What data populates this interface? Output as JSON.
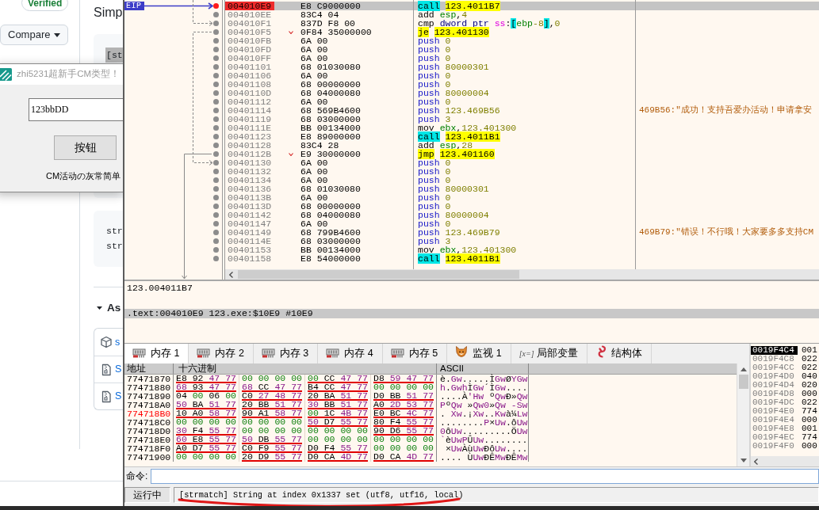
{
  "web_page": {
    "badge": "Verified",
    "compare_button": "Compare",
    "heading": "Simp",
    "code_blocks": [
      {
        "lines": [
          {
            "text": "[st",
            "selected": true
          }
        ]
      },
      {
        "lines": [
          {
            "text": "str",
            "selected": false
          },
          {
            "text": "str",
            "selected": false
          }
        ]
      }
    ],
    "section": {
      "title": "As",
      "expanded": true
    },
    "assets": [
      {
        "kind": "package",
        "name": "s"
      },
      {
        "kind": "archive",
        "name": "S"
      },
      {
        "kind": "archive",
        "name": "S"
      }
    ]
  },
  "dialog": {
    "title": "zhi5231超新手CM类型！",
    "active": false,
    "input": {
      "value": "123bbDD"
    },
    "button": "按钮",
    "label": "CM活动の灰常简单"
  },
  "debugger": {
    "disassembly": {
      "eip_label": "EIP",
      "rows": [
        {
          "address": "004010E9",
          "bytes": "E8 C9000000",
          "mnemonic": "call",
          "kind": "call",
          "operands": [
            {
              "text": "123.4011B7",
              "kind": "target"
            }
          ],
          "selected": true,
          "breakpoint": true,
          "eip": true,
          "jump_in": false,
          "jump_out": false
        },
        {
          "address": "004010EE",
          "bytes": "83C4 04",
          "mnemonic": "add",
          "kind": "plain",
          "operands": [
            {
              "text": "esp",
              "kind": "register"
            },
            {
              "text": ",",
              "kind": "plain"
            },
            {
              "text": "4",
              "kind": "number"
            }
          ],
          "selected": false,
          "breakpoint": false,
          "eip": false,
          "jump_in": false,
          "jump_out": false
        },
        {
          "address": "004010F1",
          "bytes": "837D F8 00",
          "mnemonic": "cmp",
          "kind": "plain",
          "operands": [
            {
              "text": "dword ptr ",
              "kind": "size"
            },
            {
              "text": "ss",
              "kind": "segment"
            },
            {
              "text": ":",
              "kind": "plain"
            },
            {
              "text": "[",
              "kind": "bracket"
            },
            {
              "text": "ebp",
              "kind": "register"
            },
            {
              "text": "-8",
              "kind": "number"
            },
            {
              "text": "]",
              "kind": "bracket"
            },
            {
              "text": ",",
              "kind": "plain"
            },
            {
              "text": "0",
              "kind": "number"
            }
          ],
          "selected": false,
          "breakpoint": false,
          "eip": false,
          "jump_in": true,
          "jump_out": false,
          "dashed": true
        },
        {
          "address": "004010F5",
          "bytes": "0F84 35000000",
          "mnemonic": "je",
          "kind": "jump",
          "operands": [
            {
              "text": "123.401130",
              "kind": "target"
            }
          ],
          "selected": false,
          "breakpoint": false,
          "eip": false,
          "jump_in": false,
          "jump_out": true,
          "dashed": true
        },
        {
          "address": "004010FB",
          "bytes": "6A 00",
          "mnemonic": "push",
          "kind": "push",
          "operands": [
            {
              "text": "0",
              "kind": "number"
            }
          ],
          "selected": false,
          "breakpoint": false,
          "eip": false,
          "jump_in": false,
          "jump_out": false
        },
        {
          "address": "004010FD",
          "bytes": "6A 00",
          "mnemonic": "push",
          "kind": "push",
          "operands": [
            {
              "text": "0",
              "kind": "number"
            }
          ],
          "selected": false,
          "breakpoint": false,
          "eip": false,
          "jump_in": false,
          "jump_out": false
        },
        {
          "address": "004010FF",
          "bytes": "6A 00",
          "mnemonic": "push",
          "kind": "push",
          "operands": [
            {
              "text": "0",
              "kind": "number"
            }
          ],
          "selected": false,
          "breakpoint": false,
          "eip": false,
          "jump_in": false,
          "jump_out": false
        },
        {
          "address": "00401101",
          "bytes": "68 01030080",
          "mnemonic": "push",
          "kind": "push",
          "operands": [
            {
              "text": "80000301",
              "kind": "number"
            }
          ],
          "selected": false,
          "breakpoint": false,
          "eip": false,
          "jump_in": false,
          "jump_out": false
        },
        {
          "address": "00401106",
          "bytes": "6A 00",
          "mnemonic": "push",
          "kind": "push",
          "operands": [
            {
              "text": "0",
              "kind": "number"
            }
          ],
          "selected": false,
          "breakpoint": false,
          "eip": false,
          "jump_in": false,
          "jump_out": false
        },
        {
          "address": "00401108",
          "bytes": "68 00000000",
          "mnemonic": "push",
          "kind": "push",
          "operands": [
            {
              "text": "0",
              "kind": "number"
            }
          ],
          "selected": false,
          "breakpoint": false,
          "eip": false,
          "jump_in": false,
          "jump_out": false
        },
        {
          "address": "0040110D",
          "bytes": "68 04000080",
          "mnemonic": "push",
          "kind": "push",
          "operands": [
            {
              "text": "80000004",
              "kind": "number"
            }
          ],
          "selected": false,
          "breakpoint": false,
          "eip": false,
          "jump_in": false,
          "jump_out": false
        },
        {
          "address": "00401112",
          "bytes": "6A 00",
          "mnemonic": "push",
          "kind": "push",
          "operands": [
            {
              "text": "0",
              "kind": "number"
            }
          ],
          "selected": false,
          "breakpoint": false,
          "eip": false,
          "jump_in": false,
          "jump_out": false
        },
        {
          "address": "00401114",
          "bytes": "68 569B4600",
          "mnemonic": "push",
          "kind": "push",
          "operands": [
            {
              "text": "123.469B56",
              "kind": "number"
            }
          ],
          "comment": "469B56:\"成功！支持吾爱办活动！申请拿安",
          "selected": false,
          "breakpoint": false,
          "eip": false,
          "jump_in": false,
          "jump_out": false
        },
        {
          "address": "00401119",
          "bytes": "68 03000000",
          "mnemonic": "push",
          "kind": "push",
          "operands": [
            {
              "text": "3",
              "kind": "number"
            }
          ],
          "selected": false,
          "breakpoint": false,
          "eip": false,
          "jump_in": false,
          "jump_out": false
        },
        {
          "address": "0040111E",
          "bytes": "BB 00134000",
          "mnemonic": "mov",
          "kind": "plain",
          "operands": [
            {
              "text": "ebx",
              "kind": "register"
            },
            {
              "text": ",",
              "kind": "plain"
            },
            {
              "text": "123.401300",
              "kind": "number"
            }
          ],
          "selected": false,
          "breakpoint": false,
          "eip": false,
          "jump_in": false,
          "jump_out": false
        },
        {
          "address": "00401123",
          "bytes": "E8 89000000",
          "mnemonic": "call",
          "kind": "call",
          "operands": [
            {
              "text": "123.4011B1",
              "kind": "target"
            }
          ],
          "selected": false,
          "breakpoint": false,
          "eip": false,
          "jump_in": false,
          "jump_out": false
        },
        {
          "address": "00401128",
          "bytes": "83C4 28",
          "mnemonic": "add",
          "kind": "plain",
          "operands": [
            {
              "text": "esp",
              "kind": "register"
            },
            {
              "text": ",",
              "kind": "plain"
            },
            {
              "text": "28",
              "kind": "number"
            }
          ],
          "selected": false,
          "breakpoint": false,
          "eip": false,
          "jump_in": false,
          "jump_out": false
        },
        {
          "address": "0040112B",
          "bytes": "E9 30000000",
          "mnemonic": "jmp",
          "kind": "jump",
          "operands": [
            {
              "text": "123.401160",
              "kind": "target"
            }
          ],
          "selected": false,
          "breakpoint": false,
          "eip": false,
          "jump_in": false,
          "jump_out": true,
          "dashed": false
        },
        {
          "address": "00401130",
          "bytes": "6A 00",
          "mnemonic": "push",
          "kind": "push",
          "operands": [
            {
              "text": "0",
              "kind": "number"
            }
          ],
          "selected": false,
          "breakpoint": false,
          "eip": false,
          "jump_in": true,
          "jump_out": false,
          "dashed": true
        },
        {
          "address": "00401132",
          "bytes": "6A 00",
          "mnemonic": "push",
          "kind": "push",
          "operands": [
            {
              "text": "0",
              "kind": "number"
            }
          ],
          "selected": false,
          "breakpoint": false,
          "eip": false,
          "jump_in": false,
          "jump_out": false
        },
        {
          "address": "00401134",
          "bytes": "6A 00",
          "mnemonic": "push",
          "kind": "push",
          "operands": [
            {
              "text": "0",
              "kind": "number"
            }
          ],
          "selected": false,
          "breakpoint": false,
          "eip": false,
          "jump_in": false,
          "jump_out": false
        },
        {
          "address": "00401136",
          "bytes": "68 01030080",
          "mnemonic": "push",
          "kind": "push",
          "operands": [
            {
              "text": "80000301",
              "kind": "number"
            }
          ],
          "selected": false,
          "breakpoint": false,
          "eip": false,
          "jump_in": false,
          "jump_out": false
        },
        {
          "address": "0040113B",
          "bytes": "6A 00",
          "mnemonic": "push",
          "kind": "push",
          "operands": [
            {
              "text": "0",
              "kind": "number"
            }
          ],
          "selected": false,
          "breakpoint": false,
          "eip": false,
          "jump_in": false,
          "jump_out": false
        },
        {
          "address": "0040113D",
          "bytes": "68 00000000",
          "mnemonic": "push",
          "kind": "push",
          "operands": [
            {
              "text": "0",
              "kind": "number"
            }
          ],
          "selected": false,
          "breakpoint": false,
          "eip": false,
          "jump_in": false,
          "jump_out": false
        },
        {
          "address": "00401142",
          "bytes": "68 04000080",
          "mnemonic": "push",
          "kind": "push",
          "operands": [
            {
              "text": "80000004",
              "kind": "number"
            }
          ],
          "selected": false,
          "breakpoint": false,
          "eip": false,
          "jump_in": false,
          "jump_out": false
        },
        {
          "address": "00401147",
          "bytes": "6A 00",
          "mnemonic": "push",
          "kind": "push",
          "operands": [
            {
              "text": "0",
              "kind": "number"
            }
          ],
          "selected": false,
          "breakpoint": false,
          "eip": false,
          "jump_in": false,
          "jump_out": false
        },
        {
          "address": "00401149",
          "bytes": "68 799B4600",
          "mnemonic": "push",
          "kind": "push",
          "operands": [
            {
              "text": "123.469B79",
              "kind": "number"
            }
          ],
          "comment": "469B79:\"错误！不行哦！大家要多多支持CM",
          "selected": false,
          "breakpoint": false,
          "eip": false,
          "jump_in": false,
          "jump_out": false
        },
        {
          "address": "0040114E",
          "bytes": "68 03000000",
          "mnemonic": "push",
          "kind": "push",
          "operands": [
            {
              "text": "3",
              "kind": "number"
            }
          ],
          "selected": false,
          "breakpoint": false,
          "eip": false,
          "jump_in": false,
          "jump_out": false
        },
        {
          "address": "00401153",
          "bytes": "BB 00134000",
          "mnemonic": "mov",
          "kind": "plain",
          "operands": [
            {
              "text": "ebx",
              "kind": "register"
            },
            {
              "text": ",",
              "kind": "plain"
            },
            {
              "text": "123.401300",
              "kind": "number"
            }
          ],
          "selected": false,
          "breakpoint": false,
          "eip": false,
          "jump_in": false,
          "jump_out": false
        },
        {
          "address": "00401158",
          "bytes": "E8 54000000",
          "mnemonic": "call",
          "kind": "call",
          "operands": [
            {
              "text": "123.4011B1",
              "kind": "target"
            }
          ],
          "selected": false,
          "breakpoint": false,
          "eip": false,
          "jump_in": false,
          "jump_out": false
        }
      ]
    },
    "info": {
      "label": "123.004011B7",
      "location": ".text:004010E9 123.exe:$10E9 #10E9"
    },
    "tabs": [
      {
        "label": "内存 1",
        "kind": "memory",
        "selected": true
      },
      {
        "label": "内存 2",
        "kind": "memory",
        "selected": false
      },
      {
        "label": "内存 3",
        "kind": "memory",
        "selected": false
      },
      {
        "label": "内存 4",
        "kind": "memory",
        "selected": false
      },
      {
        "label": "内存 5",
        "kind": "memory",
        "selected": false
      },
      {
        "label": "监视 1",
        "kind": "watch",
        "selected": false
      },
      {
        "label": "局部变量",
        "kind": "variable",
        "icon_text": "[x=]",
        "selected": false
      },
      {
        "label": "结构体",
        "kind": "struct",
        "selected": false
      }
    ],
    "dump": {
      "columns": [
        "地址",
        "十六进制",
        "ASCII"
      ],
      "rows": [
        {
          "address": "77471870",
          "highlighted": false,
          "groups": [
            {
              "bytes": "E8 92 47 77",
              "underlined": true
            },
            {
              "bytes": "00 00 00 00",
              "underlined": false
            },
            {
              "bytes": "00 CC 47 77",
              "underlined": true
            },
            {
              "bytes": "D8 59 47 77",
              "underlined": true
            }
          ],
          "ascii": "è.Gw.....ÌGwØYGw"
        },
        {
          "address": "77471880",
          "highlighted": false,
          "groups": [
            {
              "bytes": "68 93 47 77",
              "underlined": true
            },
            {
              "bytes": "68 CC 47 77",
              "underlined": true
            },
            {
              "bytes": "B4 CC 47 77",
              "underlined": true
            },
            {
              "bytes": "00 00 00 00",
              "underlined": false
            }
          ],
          "ascii": "h.GwhÌGw´ÌGw...."
        },
        {
          "address": "77471890",
          "highlighted": false,
          "groups": [
            {
              "bytes": "04 00 06 00",
              "underlined": false
            },
            {
              "bytes": "C0 27 48 77",
              "underlined": true
            },
            {
              "bytes": "20 BA 51 77",
              "underlined": true
            },
            {
              "bytes": "D0 BB 51 77",
              "underlined": true
            }
          ],
          "ascii": "....À'Hw ºQwÐ»Qw"
        },
        {
          "address": "774718A0",
          "highlighted": false,
          "groups": [
            {
              "bytes": "50 BA 51 77",
              "underlined": true
            },
            {
              "bytes": "20 BB 51 77",
              "underlined": true
            },
            {
              "bytes": "30 BB 51 77",
              "underlined": true
            },
            {
              "bytes": "A0 2D 53 77",
              "underlined": true
            }
          ],
          "ascii": "PºQw »Qw0»Qw -Sw"
        },
        {
          "address": "774718B0",
          "highlighted": true,
          "groups": [
            {
              "bytes": "10 A0 58 77",
              "underlined": true
            },
            {
              "bytes": "90 A1 58 77",
              "underlined": true
            },
            {
              "bytes": "00 1C 4B 77",
              "underlined": true
            },
            {
              "bytes": "E0 BC 4C 77",
              "underlined": true
            }
          ],
          "ascii": ". Xw.¡Xw..Kwà¼Lw"
        },
        {
          "address": "774718C0",
          "highlighted": false,
          "groups": [
            {
              "bytes": "00 00 00 00",
              "underlined": false
            },
            {
              "bytes": "00 00 00 00",
              "underlined": false
            },
            {
              "bytes": "50 D7 55 77",
              "underlined": true
            },
            {
              "bytes": "80 F4 55 77",
              "underlined": true
            }
          ],
          "ascii": "........P×Uw.ôUw"
        },
        {
          "address": "774718D0",
          "highlighted": false,
          "groups": [
            {
              "bytes": "30 F4 55 77",
              "underlined": true
            },
            {
              "bytes": "00 00 00 00",
              "underlined": false
            },
            {
              "bytes": "00 00 00 00",
              "underlined": false
            },
            {
              "bytes": "90 D6 55 77",
              "underlined": true
            }
          ],
          "ascii": "0ôUw.........ÖUw"
        },
        {
          "address": "774718E0",
          "highlighted": false,
          "groups": [
            {
              "bytes": "60 E8 55 77",
              "underlined": true
            },
            {
              "bytes": "50 DB 55 77",
              "underlined": true
            },
            {
              "bytes": "00 00 00 00",
              "underlined": false
            },
            {
              "bytes": "00 00 00 00",
              "underlined": false
            }
          ],
          "ascii": "`èUwPÛUw........"
        },
        {
          "address": "774718F0",
          "highlighted": false,
          "groups": [
            {
              "bytes": "A0 D7 55 77",
              "underlined": true
            },
            {
              "bytes": "C0 F9 55 77",
              "underlined": true
            },
            {
              "bytes": "D0 F4 55 77",
              "underlined": true
            },
            {
              "bytes": "00 00 00 00",
              "underlined": false
            }
          ],
          "ascii": " ×UwÀùUwÐôUw...."
        },
        {
          "address": "77471900",
          "highlighted": false,
          "groups": [
            {
              "bytes": "00 00 00 00",
              "underlined": false
            },
            {
              "bytes": "20 D9 55 77",
              "underlined": true
            },
            {
              "bytes": "D0 CA 4D 77",
              "underlined": true
            },
            {
              "bytes": "D0 CA 4D 77",
              "underlined": true
            }
          ],
          "ascii": ".... ÙUwÐÊMwÐÊMw"
        }
      ]
    },
    "stack": {
      "rows": [
        {
          "address": "0019F4C4",
          "value": "001",
          "selected": true
        },
        {
          "address": "0019F4C8",
          "value": "022",
          "selected": false
        },
        {
          "address": "0019F4CC",
          "value": "022",
          "selected": false
        },
        {
          "address": "0019F4D0",
          "value": "040",
          "selected": false
        },
        {
          "address": "0019F4D4",
          "value": "020",
          "selected": false
        },
        {
          "address": "0019F4D8",
          "value": "000",
          "selected": false
        },
        {
          "address": "0019F4DC",
          "value": "022",
          "selected": false
        },
        {
          "address": "0019F4E0",
          "value": "774",
          "selected": false
        },
        {
          "address": "0019F4E4",
          "value": "000",
          "selected": false
        },
        {
          "address": "0019F4E8",
          "value": "001",
          "selected": false
        },
        {
          "address": "0019F4EC",
          "value": "774",
          "selected": false
        },
        {
          "address": "0019F4F0",
          "value": "000",
          "selected": false
        }
      ]
    },
    "command": {
      "label": "命令:"
    },
    "status_bar": {
      "state": "运行中",
      "message": "[strmatch] String at index 0x1337 set (utf8, utf16, local)",
      "marked": true
    }
  }
}
